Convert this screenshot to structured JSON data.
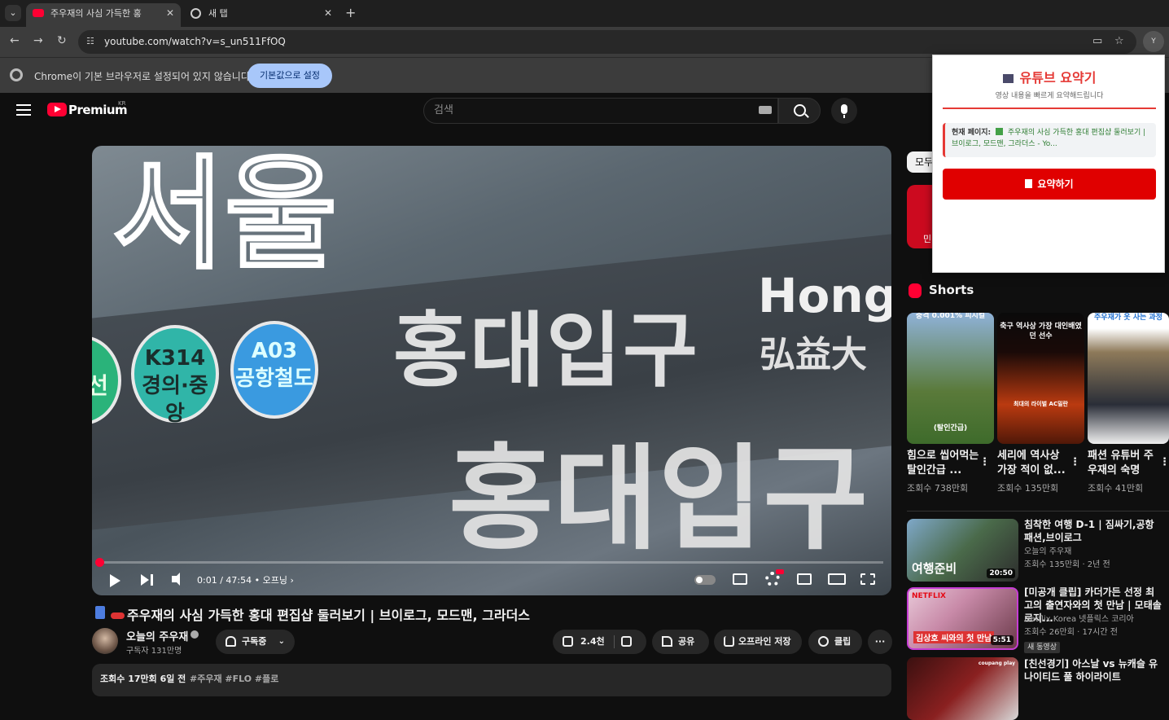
{
  "browser": {
    "tabs": [
      {
        "label": "주우재의 사심 가득한 홍",
        "active": true
      },
      {
        "label": "새 탭",
        "active": false
      }
    ],
    "url": "youtube.com/watch?v=s_un511FfOQ",
    "profile_initial": "Y",
    "infobar_text": "Chrome이 기본 브라우저로 설정되어 있지 않습니다",
    "infobar_button": "기본값으로 설정"
  },
  "youtube": {
    "brand": "Premium",
    "region": "KR",
    "search_placeholder": "검색"
  },
  "player": {
    "overlay_top": "서울",
    "overlay_bottom": "홍대입구",
    "sign_main": "홍대입구",
    "sign_english": "Hong",
    "sign_hanja": "弘益大",
    "badge_left": "선",
    "badge_k314_code": "K314",
    "badge_k314_line": "경의·중앙",
    "badge_a03_code": "A03",
    "badge_a03_line": "공항철도",
    "time": "0:01 / 47:54",
    "chapter": "• 오프닝",
    "progress_fraction": 0.001,
    "accent": "#ff0033"
  },
  "video": {
    "title": "주우재의 사심 가득한 홍대 편집샵 둘러보기 | 브이로그, 모드맨, 그라더스",
    "channel": "오늘의 주우재",
    "subscribers": "구독자 131만명",
    "subscribe_label": "구독중",
    "likes": "2.4천",
    "share": "공유",
    "offline": "오프라인 저장",
    "clip": "클립",
    "more": "···",
    "views_age": "조회수 17만회  6일 전",
    "tags": "#주우재 #FLO #플로"
  },
  "sidebar": {
    "chip": "모두",
    "ad_text": "민",
    "shorts_heading": "Shorts",
    "shorts": [
      {
        "caption": "(탈인간급)",
        "title": "힘으로 씹어먹는 탈인간급 ...",
        "views": "조회수 738만회",
        "top": "충격 0.001% 피지컬"
      },
      {
        "caption": "축구 역사상 가장 대인배였던 선수",
        "title": "세리에 역사상 가장 적이 없...",
        "views": "조회수 135만회",
        "bottom": "최대의 라이벌 AC밀란"
      },
      {
        "caption": "주우재가 옷 사는 과정",
        "title": "패션 유튜버 주우재의 숙명",
        "views": "조회수 41만회"
      }
    ],
    "recommended": [
      {
        "title": "침착한 여행 D-1 | 짐싸기,공항패션,브이로그",
        "channel": "오늘의 주우재",
        "meta": "조회수 135만회 · 2년 전",
        "duration": "20:50",
        "overlay": "여행준비"
      },
      {
        "title": "[미공개 클립] 카더가든 선정 최고의 출연자와의 첫 만남 | 모태솔로지...",
        "channel": "Netflix Korea 넷플릭스 코리아",
        "meta": "조회수 26만회 · 17시간 전",
        "duration": "5:51",
        "overlay": "김상호 씨와의 첫 만남",
        "badge": "새 동영상",
        "tag": "NETFLIX"
      },
      {
        "title": "[친선경기] 아스날 vs 뉴캐슬 유나이티드 풀 하이라이트",
        "channel": "",
        "meta": "",
        "duration": "",
        "overlay": "",
        "tag": "coupang play"
      }
    ]
  },
  "extension": {
    "title": "유튜브 요약기",
    "subtitle": "영상 내용을 빠르게 요약해드립니다",
    "page_label": "현재 페이지:",
    "page_value": "주우재의 사심 가득한 홍대 편집샵 둘러보기 | 브이로그, 모드맨, 그라더스 - Yo...",
    "button": "요약하기",
    "accent": "#e53935"
  }
}
